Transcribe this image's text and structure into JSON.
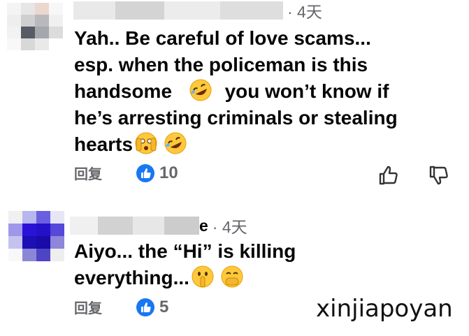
{
  "comments": [
    {
      "author_visible": "",
      "time": "· 4天",
      "body_lines": [
        "Yah.. Be careful of love scams...",
        "esp. when the policeman is this",
        "handsome",
        "you won’t know if",
        "he’s arresting criminals or stealing",
        "hearts"
      ],
      "reply_label": "回复",
      "likes": "10",
      "emojis": [
        "rofl-emoji",
        "peeking-eye-emoji",
        "rofl-emoji"
      ]
    },
    {
      "author_visible": "e",
      "time": "· 4天",
      "body_lines": [
        "Aiyo... the “Hi” is killing",
        "everything..."
      ],
      "reply_label": "回复",
      "likes": "5",
      "emojis": [
        "shushing-face-emoji",
        "hand-over-mouth-emoji"
      ]
    }
  ],
  "watermark": "xinjiapoyan",
  "colors": {
    "secondary_text": "#65676b",
    "like_blue": "#1877f2",
    "emoji_yellow": "#ffc83d"
  }
}
